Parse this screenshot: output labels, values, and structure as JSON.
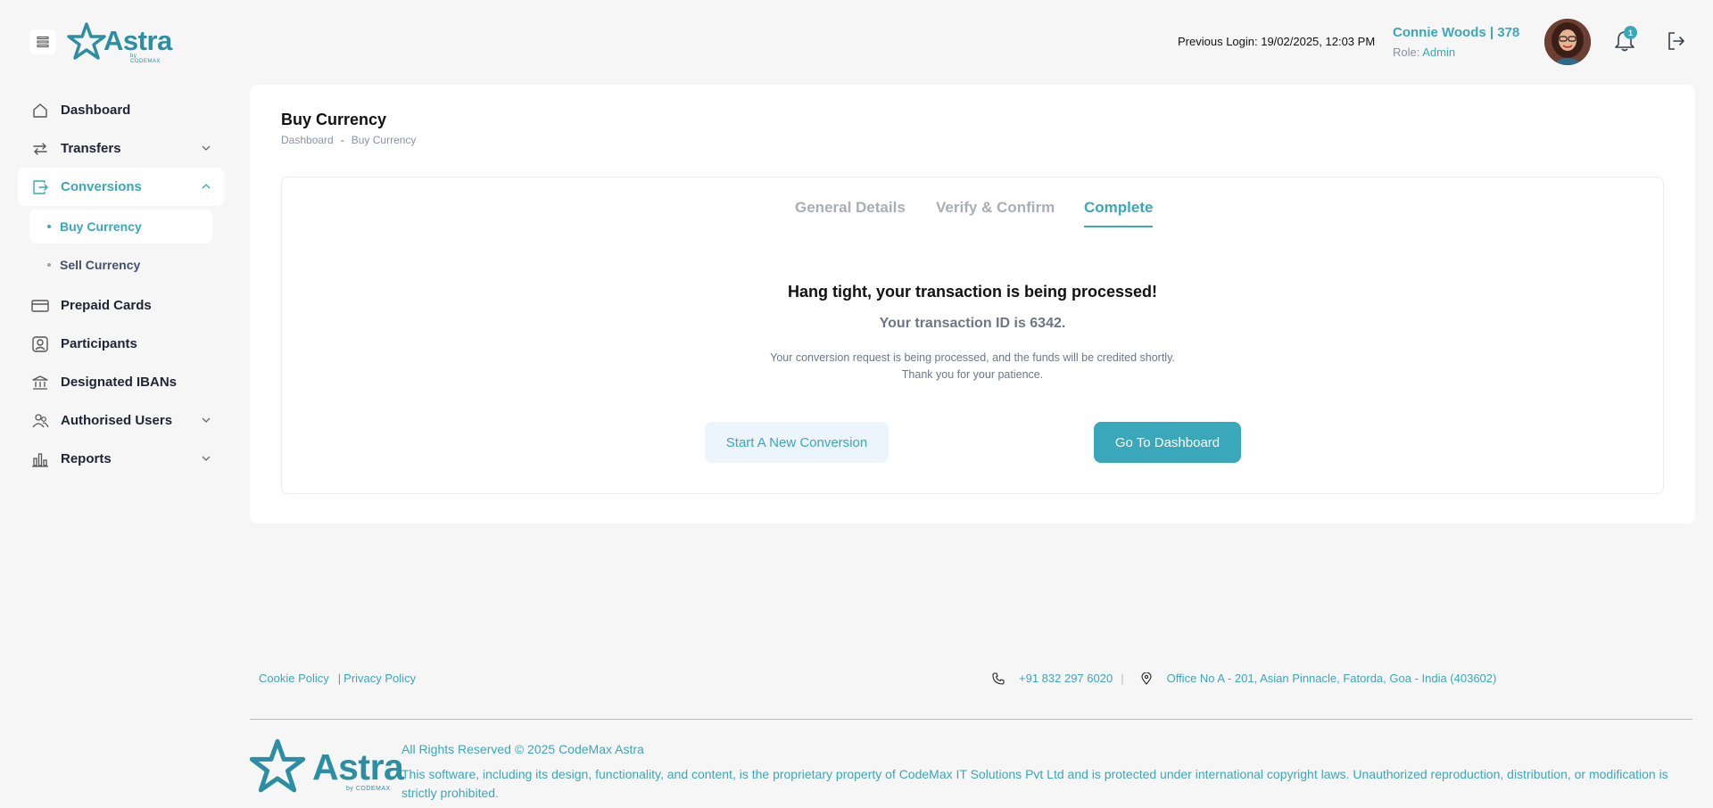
{
  "header": {
    "logo_text": "Astra",
    "logo_sub": "by CODEMAX",
    "previous_login": "Previous Login: 19/02/2025, 12:03 PM",
    "user_name": "Connie Woods | 378",
    "role_label": "Role:",
    "role_value": "Admin",
    "notification_count": "1"
  },
  "sidebar": {
    "items": [
      {
        "label": "Dashboard"
      },
      {
        "label": "Transfers"
      },
      {
        "label": "Conversions"
      },
      {
        "label": "Prepaid Cards"
      },
      {
        "label": "Participants"
      },
      {
        "label": "Designated IBANs"
      },
      {
        "label": "Authorised Users"
      },
      {
        "label": "Reports"
      }
    ],
    "conversions_sub": [
      {
        "label": "Buy Currency"
      },
      {
        "label": "Sell Currency"
      }
    ]
  },
  "main": {
    "title": "Buy Currency",
    "breadcrumb": [
      "Dashboard",
      "Buy Currency"
    ],
    "tabs": [
      {
        "label": "General Details"
      },
      {
        "label": "Verify & Confirm"
      },
      {
        "label": "Complete"
      }
    ],
    "message_title": "Hang tight, your transaction is being processed!",
    "message_tx": "Your transaction ID is 6342.",
    "message_line1": "Your conversion request is being processed, and the funds will be credited shortly.",
    "message_line2": "Thank you for your patience.",
    "btn_new": "Start A New Conversion",
    "btn_dashboard": "Go To Dashboard"
  },
  "footer": {
    "cookie": "Cookie Policy",
    "privacy": "Privacy Policy",
    "phone": "+91 832 297 6020",
    "address": "Office No A - 201, Asian Pinnacle, Fatorda, Goa - India (403602)",
    "rights": "All Rights Reserved © 2025 CodeMax Astra",
    "legal": "This software, including its design, functionality, and content, is the proprietary property of CodeMax IT Solutions Pvt Ltd and is protected under international copyright laws. Unauthorized reproduction, distribution, or modification is strictly prohibited."
  },
  "colors": {
    "accent": "#3aa7ba",
    "logo": "#2c8ea3",
    "background": "#f6f6f6"
  }
}
